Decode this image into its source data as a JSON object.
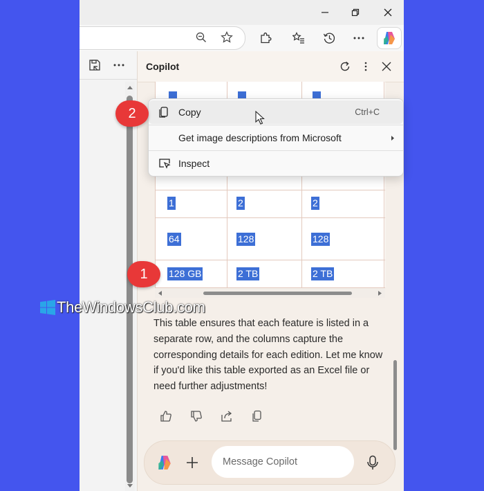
{
  "window": {
    "minimize_icon": "minimize-icon",
    "restore_icon": "restore-icon",
    "close_icon": "close-icon"
  },
  "toolbar": {
    "icons": [
      "zoom-out-icon",
      "favorite-star-icon",
      "extensions-icon",
      "favorites-icon",
      "history-icon",
      "more-icon",
      "copilot-icon"
    ]
  },
  "copilot": {
    "title": "Copilot",
    "header_icons": [
      "refresh-icon",
      "more-vertical-icon",
      "close-icon"
    ]
  },
  "table": {
    "rows": [
      [
        "1",
        "2",
        "2"
      ],
      [
        "64",
        "128",
        "128"
      ],
      [
        "128 GB",
        "2 TB",
        "2 TB"
      ]
    ]
  },
  "context_menu": {
    "items": [
      {
        "label": "Copy",
        "shortcut": "Ctrl+C",
        "icon": "copy-icon"
      },
      {
        "label": "Get image descriptions from Microsoft",
        "submenu": true
      },
      {
        "label": "Inspect",
        "icon": "inspect-icon"
      }
    ]
  },
  "callouts": [
    "1",
    "2"
  ],
  "watermark": "TheWindowsClub.com",
  "response": {
    "text": "This table ensures that each feature is listed in a separate row, and the columns capture the corresponding details for each edition. Let me know if you'd like this table exported as an Excel file or need further adjustments!"
  },
  "composer": {
    "placeholder": "Message Copilot"
  },
  "colors": {
    "background": "#4455ee",
    "selection": "#3d6fd6",
    "callout": "#e83838",
    "panel": "#f5efe9"
  }
}
